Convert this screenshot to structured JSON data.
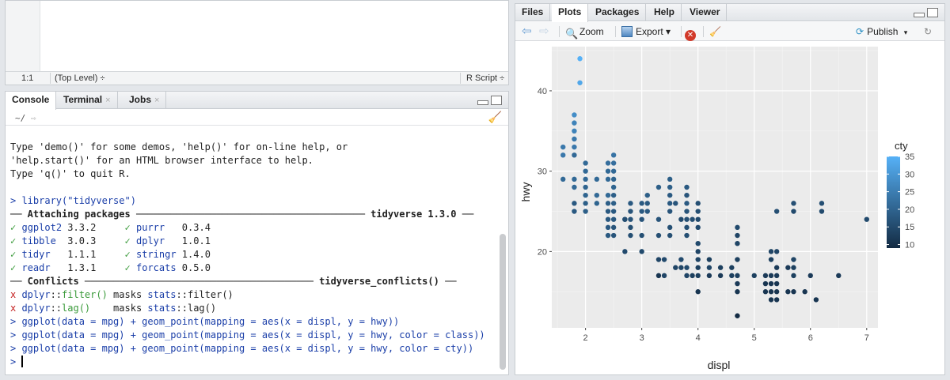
{
  "editor": {
    "status": {
      "position": "1:1",
      "scope": "(Top Level) ÷",
      "file_type": "R Script ÷"
    }
  },
  "console": {
    "tabs": [
      {
        "label": "Console"
      },
      {
        "label": "Terminal",
        "close": "×"
      },
      {
        "label": "Jobs",
        "close": "×"
      }
    ],
    "path": "~/",
    "lines": {
      "l1": "Type 'demo()' for some demos, 'help()' for on-line help, or",
      "l2": "'help.start()' for an HTML browser interface to help.",
      "l3": "Type 'q()' to quit R.",
      "cmd1": "> library(\"tidyverse\")",
      "attach_hdr": "── Attaching packages ──────────────────────────────────────── tidyverse 1.3.0 ──",
      "pk": [
        [
          "✓",
          "ggplot2",
          " 3.3.2",
          "✓",
          "purrr  ",
          " 0.3.4"
        ],
        [
          "✓",
          "tibble ",
          " 3.0.3",
          "✓",
          "dplyr  ",
          " 1.0.1"
        ],
        [
          "✓",
          "tidyr  ",
          " 1.1.1",
          "✓",
          "stringr",
          " 1.4.0"
        ],
        [
          "✓",
          "readr  ",
          " 1.3.1",
          "✓",
          "forcats",
          " 0.5.0"
        ]
      ],
      "conf_hdr": "── Conflicts ──────────────────────────────────────── tidyverse_conflicts() ──",
      "conf1_pre": "x ",
      "conf1_pkg": "dplyr",
      "conf1_sep": "::",
      "conf1_fn": "filter()",
      "conf1_rest": " masks ",
      "conf1_pkg2": "stats",
      "conf1_sep2": "::",
      "conf1_fn2": "filter()",
      "conf2_pre": "x ",
      "conf2_pkg": "dplyr",
      "conf2_sep": "::",
      "conf2_fn": "lag()",
      "conf2_rest": "    masks ",
      "conf2_pkg2": "stats",
      "conf2_sep2": "::",
      "conf2_fn2": "lag()",
      "cmd2": "> ggplot(data = mpg) + geom_point(mapping = aes(x = displ, y = hwy))",
      "cmd3": "> ggplot(data = mpg) + geom_point(mapping = aes(x = displ, y = hwy, color = class))",
      "cmd4": "> ggplot(data = mpg) + geom_point(mapping = aes(x = displ, y = hwy, color = cty))",
      "prompt": "> "
    }
  },
  "viewer": {
    "tabs": [
      "Files",
      "Plots",
      "Packages",
      "Help",
      "Viewer"
    ],
    "toolbar": {
      "zoom": "Zoom",
      "export": "Export ▾",
      "publish": "Publish",
      "publish_caret": "▾"
    }
  },
  "chart_data": {
    "type": "scatter",
    "xlabel": "displ",
    "ylabel": "hwy",
    "xlim": [
      1.4,
      7.2
    ],
    "ylim": [
      10.5,
      45.5
    ],
    "xticks": [
      "2",
      "3",
      "4",
      "5",
      "6",
      "7"
    ],
    "yticks": [
      "20",
      "30",
      "40"
    ],
    "legend": {
      "title": "cty",
      "labels": [
        "35",
        "30",
        "25",
        "20",
        "15",
        "10"
      ],
      "range": [
        9,
        35
      ],
      "low_color": "#132b43",
      "high_color": "#56b1f7",
      "placement": "right"
    },
    "points": [
      [
        1.9,
        44,
        35
      ],
      [
        1.9,
        41,
        33
      ],
      [
        1.8,
        37,
        28
      ],
      [
        1.8,
        36,
        26
      ],
      [
        1.8,
        35,
        26
      ],
      [
        1.8,
        34,
        24
      ],
      [
        1.8,
        33,
        24
      ],
      [
        1.6,
        33,
        24
      ],
      [
        1.6,
        32,
        24
      ],
      [
        1.8,
        32,
        21
      ],
      [
        1.6,
        29,
        21
      ],
      [
        1.8,
        29,
        21
      ],
      [
        1.8,
        28,
        21
      ],
      [
        1.8,
        26,
        18
      ],
      [
        1.8,
        25,
        18
      ],
      [
        2.0,
        31,
        21
      ],
      [
        2.0,
        30,
        21
      ],
      [
        2.0,
        29,
        21
      ],
      [
        2.0,
        28,
        20
      ],
      [
        2.0,
        27,
        20
      ],
      [
        2.0,
        26,
        19
      ],
      [
        2.0,
        25,
        19
      ],
      [
        2.2,
        29,
        21
      ],
      [
        2.2,
        27,
        21
      ],
      [
        2.2,
        26,
        20
      ],
      [
        2.4,
        31,
        22
      ],
      [
        2.4,
        30,
        21
      ],
      [
        2.4,
        29,
        21
      ],
      [
        2.4,
        27,
        21
      ],
      [
        2.4,
        26,
        19
      ],
      [
        2.4,
        25,
        18
      ],
      [
        2.4,
        24,
        18
      ],
      [
        2.4,
        23,
        18
      ],
      [
        2.4,
        22,
        18
      ],
      [
        2.5,
        32,
        23
      ],
      [
        2.5,
        31,
        22
      ],
      [
        2.5,
        30,
        21
      ],
      [
        2.5,
        29,
        20
      ],
      [
        2.5,
        28,
        20
      ],
      [
        2.5,
        27,
        19
      ],
      [
        2.5,
        26,
        19
      ],
      [
        2.5,
        25,
        18
      ],
      [
        2.5,
        24,
        18
      ],
      [
        2.5,
        23,
        17
      ],
      [
        2.5,
        22,
        17
      ],
      [
        2.7,
        24,
        17
      ],
      [
        2.7,
        20,
        15
      ],
      [
        2.7,
        24,
        16
      ],
      [
        2.8,
        26,
        18
      ],
      [
        2.8,
        25,
        17
      ],
      [
        2.8,
        24,
        17
      ],
      [
        2.8,
        23,
        16
      ],
      [
        2.8,
        22,
        16
      ],
      [
        3.0,
        26,
        18
      ],
      [
        3.0,
        25,
        18
      ],
      [
        3.0,
        24,
        17
      ],
      [
        3.0,
        22,
        16
      ],
      [
        3.0,
        20,
        15
      ],
      [
        3.1,
        27,
        19
      ],
      [
        3.1,
        26,
        18
      ],
      [
        3.1,
        25,
        18
      ],
      [
        3.3,
        28,
        19
      ],
      [
        3.3,
        24,
        17
      ],
      [
        3.3,
        22,
        16
      ],
      [
        3.3,
        19,
        14
      ],
      [
        3.3,
        17,
        11
      ],
      [
        3.4,
        19,
        15
      ],
      [
        3.4,
        17,
        14
      ],
      [
        3.5,
        29,
        19
      ],
      [
        3.5,
        28,
        19
      ],
      [
        3.5,
        27,
        18
      ],
      [
        3.5,
        26,
        18
      ],
      [
        3.5,
        25,
        17
      ],
      [
        3.5,
        23,
        16
      ],
      [
        3.5,
        22,
        16
      ],
      [
        3.6,
        26,
        17
      ],
      [
        3.6,
        18,
        14
      ],
      [
        3.7,
        24,
        15
      ],
      [
        3.7,
        19,
        15
      ],
      [
        3.7,
        18,
        14
      ],
      [
        3.8,
        28,
        18
      ],
      [
        3.8,
        27,
        17
      ],
      [
        3.8,
        26,
        18
      ],
      [
        3.8,
        25,
        17
      ],
      [
        3.8,
        24,
        16
      ],
      [
        3.8,
        23,
        16
      ],
      [
        3.8,
        22,
        16
      ],
      [
        3.8,
        17,
        14
      ],
      [
        3.8,
        18,
        15
      ],
      [
        3.9,
        24,
        16
      ],
      [
        3.9,
        17,
        13
      ],
      [
        4.0,
        26,
        16
      ],
      [
        4.0,
        25,
        16
      ],
      [
        4.0,
        24,
        15
      ],
      [
        4.0,
        23,
        15
      ],
      [
        4.0,
        21,
        15
      ],
      [
        4.0,
        20,
        14
      ],
      [
        4.0,
        19,
        14
      ],
      [
        4.0,
        18,
        13
      ],
      [
        4.0,
        17,
        13
      ],
      [
        4.0,
        15,
        11
      ],
      [
        4.2,
        19,
        13
      ],
      [
        4.2,
        18,
        14
      ],
      [
        4.2,
        17,
        12
      ],
      [
        4.4,
        18,
        13
      ],
      [
        4.4,
        17,
        12
      ],
      [
        4.6,
        17,
        13
      ],
      [
        4.6,
        18,
        13
      ],
      [
        4.7,
        23,
        15
      ],
      [
        4.7,
        22,
        14
      ],
      [
        4.7,
        21,
        14
      ],
      [
        4.7,
        19,
        13
      ],
      [
        4.7,
        17,
        13
      ],
      [
        4.7,
        16,
        12
      ],
      [
        4.7,
        15,
        11
      ],
      [
        4.7,
        12,
        9
      ],
      [
        5.0,
        17,
        13
      ],
      [
        5.2,
        17,
        12
      ],
      [
        5.2,
        16,
        11
      ],
      [
        5.2,
        15,
        11
      ],
      [
        5.3,
        20,
        14
      ],
      [
        5.3,
        19,
        13
      ],
      [
        5.3,
        17,
        12
      ],
      [
        5.3,
        16,
        11
      ],
      [
        5.3,
        15,
        11
      ],
      [
        5.3,
        14,
        11
      ],
      [
        5.4,
        25,
        16
      ],
      [
        5.4,
        20,
        14
      ],
      [
        5.4,
        18,
        12
      ],
      [
        5.4,
        17,
        12
      ],
      [
        5.4,
        16,
        11
      ],
      [
        5.4,
        15,
        11
      ],
      [
        5.4,
        14,
        11
      ],
      [
        5.6,
        18,
        12
      ],
      [
        5.6,
        15,
        11
      ],
      [
        5.7,
        26,
        16
      ],
      [
        5.7,
        25,
        15
      ],
      [
        5.7,
        19,
        14
      ],
      [
        5.7,
        18,
        13
      ],
      [
        5.7,
        17,
        13
      ],
      [
        5.7,
        15,
        11
      ],
      [
        5.9,
        15,
        11
      ],
      [
        6.0,
        17,
        12
      ],
      [
        6.1,
        14,
        11
      ],
      [
        6.2,
        26,
        16
      ],
      [
        6.2,
        25,
        15
      ],
      [
        6.5,
        17,
        12
      ],
      [
        7.0,
        24,
        15
      ]
    ]
  }
}
